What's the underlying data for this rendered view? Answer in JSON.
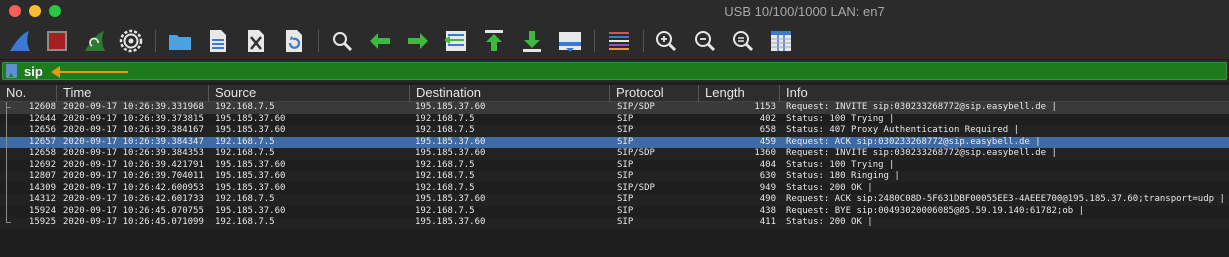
{
  "window": {
    "title": "USB 10/100/1000 LAN: en7"
  },
  "toolbar": {
    "buttons": [
      {
        "name": "start-capture-button",
        "icon": "shark-fin-icon"
      },
      {
        "name": "stop-capture-button",
        "icon": "stop-icon"
      },
      {
        "name": "restart-capture-button",
        "icon": "restart-fin-icon"
      },
      {
        "name": "capture-options-button",
        "icon": "gear-icon"
      },
      {
        "name": "open-file-button",
        "icon": "folder-icon"
      },
      {
        "name": "save-file-button",
        "icon": "file-icon"
      },
      {
        "name": "close-file-button",
        "icon": "close-file-icon"
      },
      {
        "name": "reload-file-button",
        "icon": "reload-icon"
      },
      {
        "name": "find-packet-button",
        "icon": "magnifier-icon"
      },
      {
        "name": "go-back-button",
        "icon": "arrow-left-icon"
      },
      {
        "name": "go-forward-button",
        "icon": "arrow-right-icon"
      },
      {
        "name": "go-to-packet-button",
        "icon": "jump-icon"
      },
      {
        "name": "go-first-button",
        "icon": "arrow-up-bar-icon"
      },
      {
        "name": "go-last-button",
        "icon": "arrow-down-bar-icon"
      },
      {
        "name": "auto-scroll-button",
        "icon": "autoscroll-icon"
      },
      {
        "name": "colorize-button",
        "icon": "colorize-icon"
      },
      {
        "name": "zoom-in-button",
        "icon": "zoom-in-icon"
      },
      {
        "name": "zoom-out-button",
        "icon": "zoom-out-icon"
      },
      {
        "name": "zoom-normal-button",
        "icon": "zoom-normal-icon"
      },
      {
        "name": "resize-columns-button",
        "icon": "resize-columns-icon"
      }
    ]
  },
  "filter": {
    "value": "sip",
    "accent": "#1d7a1d",
    "annotation_color": "#f0960e"
  },
  "columns": [
    "No.",
    "Time",
    "Source",
    "Destination",
    "Protocol",
    "Length",
    "Info"
  ],
  "packets": [
    {
      "no": "12608",
      "time": "2020-09-17 10:26:39.331968",
      "src": "192.168.7.5",
      "dst": "195.185.37.60",
      "proto": "SIP/SDP",
      "len": "1153",
      "info": "Request: INVITE sip:030233268772@sip.easybell.de |"
    },
    {
      "no": "12644",
      "time": "2020-09-17 10:26:39.373815",
      "src": "195.185.37.60",
      "dst": "192.168.7.5",
      "proto": "SIP",
      "len": "402",
      "info": "Status: 100 Trying |"
    },
    {
      "no": "12656",
      "time": "2020-09-17 10:26:39.384167",
      "src": "195.185.37.60",
      "dst": "192.168.7.5",
      "proto": "SIP",
      "len": "658",
      "info": "Status: 407 Proxy Authentication Required |"
    },
    {
      "no": "12657",
      "time": "2020-09-17 10:26:39.384347",
      "src": "192.168.7.5",
      "dst": "195.185.37.60",
      "proto": "SIP",
      "len": "459",
      "info": "Request: ACK sip:030233268772@sip.easybell.de |"
    },
    {
      "no": "12658",
      "time": "2020-09-17 10:26:39.384353",
      "src": "192.168.7.5",
      "dst": "195.185.37.60",
      "proto": "SIP/SDP",
      "len": "1360",
      "info": "Request: INVITE sip:030233268772@sip.easybell.de |"
    },
    {
      "no": "12692",
      "time": "2020-09-17 10:26:39.421791",
      "src": "195.185.37.60",
      "dst": "192.168.7.5",
      "proto": "SIP",
      "len": "404",
      "info": "Status: 100 Trying |"
    },
    {
      "no": "12807",
      "time": "2020-09-17 10:26:39.704011",
      "src": "195.185.37.60",
      "dst": "192.168.7.5",
      "proto": "SIP",
      "len": "630",
      "info": "Status: 180 Ringing |"
    },
    {
      "no": "14309",
      "time": "2020-09-17 10:26:42.600953",
      "src": "195.185.37.60",
      "dst": "192.168.7.5",
      "proto": "SIP/SDP",
      "len": "949",
      "info": "Status: 200 OK |"
    },
    {
      "no": "14312",
      "time": "2020-09-17 10:26:42.601733",
      "src": "192.168.7.5",
      "dst": "195.185.37.60",
      "proto": "SIP",
      "len": "490",
      "info": "Request: ACK sip:2480C08D-5F631DBF00055EE3-4AEEE700@195.185.37.60;transport=udp |"
    },
    {
      "no": "15924",
      "time": "2020-09-17 10:26:45.070755",
      "src": "195.185.37.60",
      "dst": "192.168.7.5",
      "proto": "SIP",
      "len": "438",
      "info": "Request: BYE sip:00493020006085@85.59.19.140:61782;ob |"
    },
    {
      "no": "15925",
      "time": "2020-09-17 10:26:45.071099",
      "src": "192.168.7.5",
      "dst": "195.185.37.60",
      "proto": "SIP",
      "len": "411",
      "info": "Status: 200 OK |"
    }
  ],
  "selected_row": 3
}
